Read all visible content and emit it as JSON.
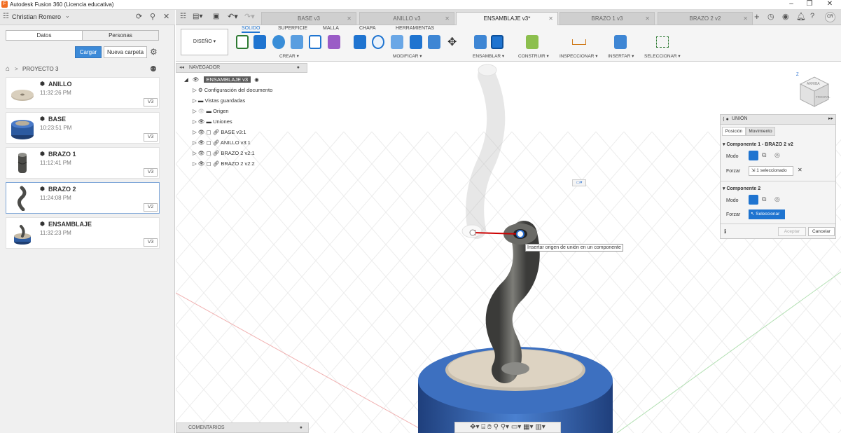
{
  "window": {
    "title": "Autodesk Fusion 360 (Licencia educativa)"
  },
  "user": {
    "name": "Christian Romero",
    "initials": "CR"
  },
  "data_panel": {
    "tabs": [
      "Datos",
      "Personas"
    ],
    "upload_label": "Cargar",
    "new_folder_label": "Nueva carpeta",
    "breadcrumb": "PROYECTO 3",
    "files": [
      {
        "name": "ANILLO",
        "time": "11:32:26 PM",
        "version": "V3"
      },
      {
        "name": "BASE",
        "time": "10:23:51 PM",
        "version": "V3"
      },
      {
        "name": "BRAZO 1",
        "time": "11:12:41 PM",
        "version": "V3"
      },
      {
        "name": "BRAZO 2",
        "time": "11:24:08 PM",
        "version": "V2"
      },
      {
        "name": "ENSAMBLAJE",
        "time": "11:32:23 PM",
        "version": "V3"
      }
    ]
  },
  "doc_tabs": [
    {
      "label": "BASE v3",
      "active": false
    },
    {
      "label": "ANILLO v3",
      "active": false
    },
    {
      "label": "ENSAMBLAJE v3*",
      "active": true
    },
    {
      "label": "BRAZO 1 v3",
      "active": false
    },
    {
      "label": "BRAZO 2 v2",
      "active": false
    }
  ],
  "ribbon": {
    "workspace": "DISEÑO",
    "tabs": [
      "SOLIDO",
      "SUPERFICIE",
      "MALLA",
      "CHAPA",
      "HERRAMIENTAS"
    ],
    "active_tab": "SOLIDO",
    "groups": [
      "CREAR",
      "MODIFICAR",
      "ENSAMBLAR",
      "CONSTRUIR",
      "INSPECCIONAR",
      "INSERTAR",
      "SELECCIONAR"
    ]
  },
  "navigator": {
    "title": "NAVEGADOR",
    "root": "ENSAMBLAJE v3",
    "items": [
      "Configuración del documento",
      "Vistas guardadas",
      "Origen",
      "Uniones",
      "BASE v3:1",
      "ANILLO v3:1",
      "BRAZO 2 v2:1",
      "BRAZO 2 v2:2"
    ]
  },
  "joint_panel": {
    "title": "UNIÓN",
    "tabs": [
      "Posición",
      "Movimiento"
    ],
    "comp1_title": "Componente 1 - BRAZO 2 v2",
    "comp2_title": "Componente 2",
    "mode_label": "Modo",
    "force_label": "Forzar",
    "comp1_selection": "1 seleccionado",
    "comp2_selection": "Seleccionar",
    "ok_label": "Aceptar",
    "cancel_label": "Cancelar"
  },
  "tooltip": "Insertar origen de unión en un componente",
  "comments_label": "COMENTARIOS",
  "viewcube": {
    "top": "ARRIBA",
    "front": "FRONTAL"
  },
  "colors": {
    "accent": "#1f74d0",
    "base_blue": "#3a6fbf",
    "arm_gray": "#5a5a58"
  }
}
